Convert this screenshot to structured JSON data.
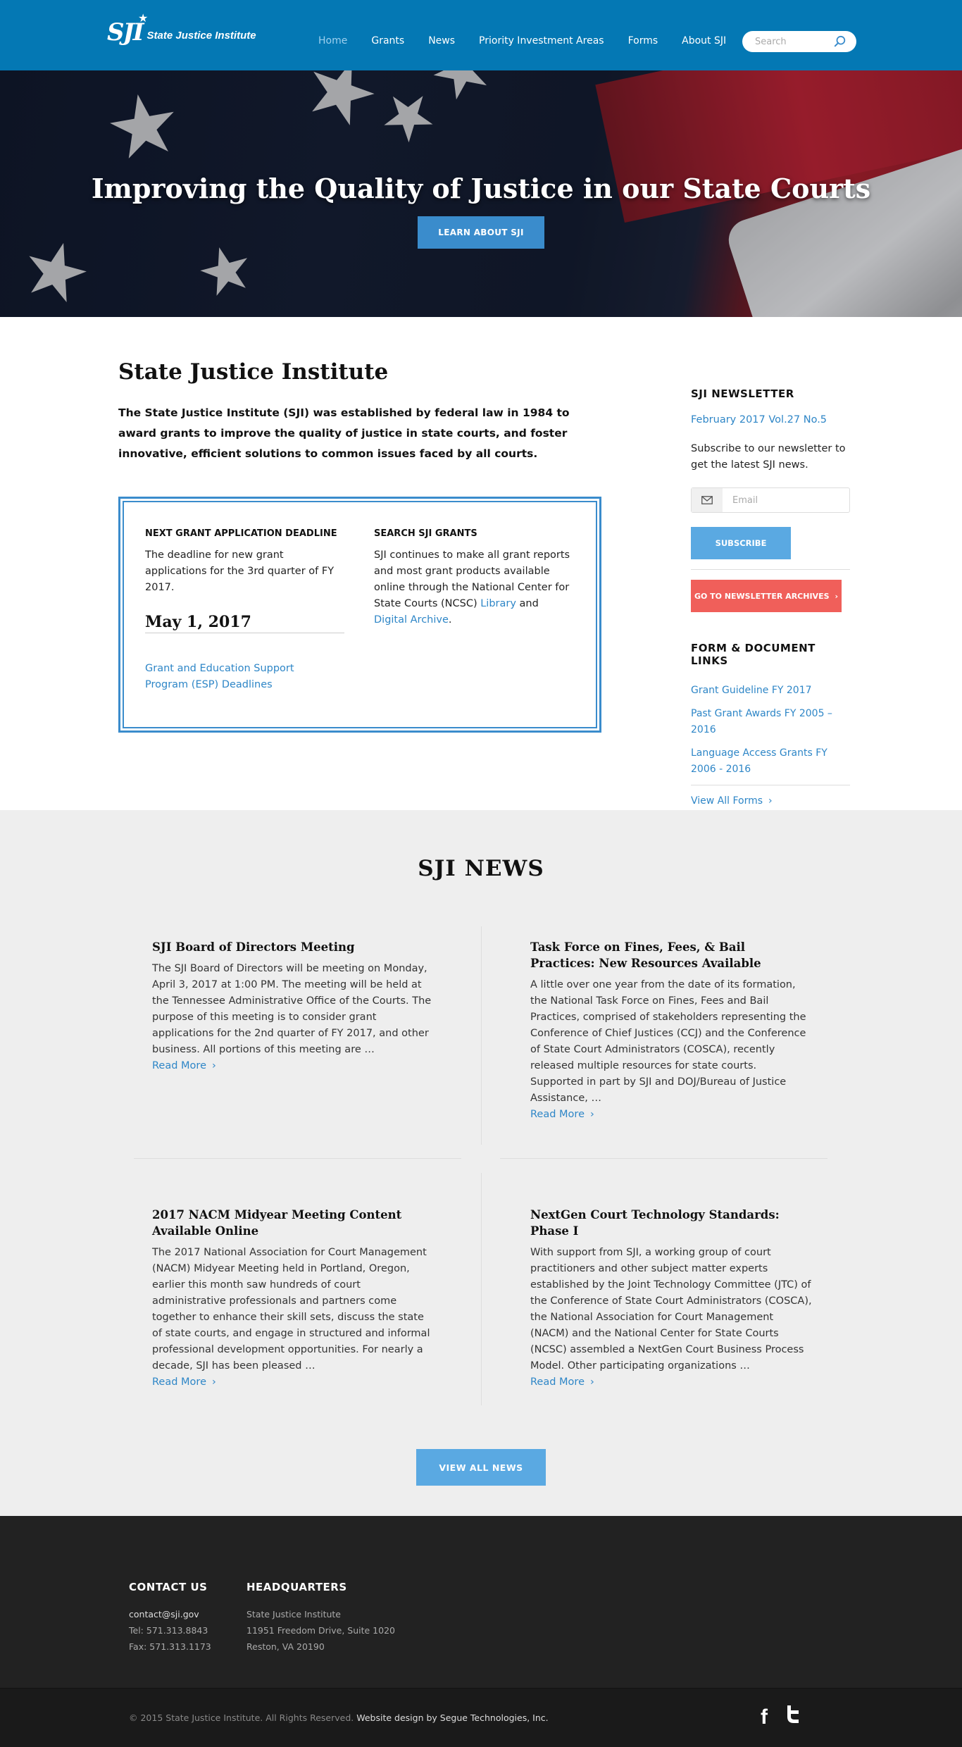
{
  "header": {
    "logo_mark": "SJI",
    "logo_text": "State Justice Institute",
    "nav": [
      "Home",
      "Grants",
      "News",
      "Priority Investment Areas",
      "Forms",
      "About SJI"
    ],
    "search_placeholder": "Search"
  },
  "hero": {
    "title": "Improving the Quality of Justice in our State Courts",
    "button": "LEARN ABOUT SJI"
  },
  "intro": {
    "title": "State Justice Institute",
    "text": "The State Justice Institute (SJI) was established by federal law in 1984 to award grants to improve the quality of justice in state courts, and foster innovative, efficient solutions to common issues faced by all courts."
  },
  "grant_box": {
    "deadline_heading": "NEXT GRANT APPLICATION DEADLINE",
    "deadline_text": "The deadline for new grant applications for the 3rd quarter of FY 2017.",
    "deadline_date": "May 1, 2017",
    "esp_link": "Grant and Education Support Program (ESP) Deadlines",
    "search_heading": "SEARCH SJI GRANTS",
    "search_text_1": "SJI continues to make all grant reports and most grant products available online through the National Center for State Courts (NCSC) ",
    "search_link_1": "Library",
    "search_text_2": " and ",
    "search_link_2": "Digital Archive",
    "search_text_3": "."
  },
  "sidebar": {
    "newsletter_heading": "SJI NEWSLETTER",
    "newsletter_issue": "February 2017 Vol.27 No.5",
    "newsletter_text": "Subscribe to our newsletter to get the latest SJI news.",
    "email_placeholder": "Email",
    "subscribe_button": "SUBSCRIBE",
    "archives_button": "GO TO NEWSLETTER ARCHIVES",
    "forms_heading": "FORM & DOCUMENT LINKS",
    "form_links": [
      "Grant Guideline FY 2017",
      "Past Grant Awards FY 2005 – 2016",
      "Language Access Grants FY 2006 - 2016"
    ],
    "view_all_forms": "View All Forms"
  },
  "news": {
    "title": "SJI NEWS",
    "articles": [
      {
        "title": "SJI Board of Directors Meeting",
        "body": "The SJI Board of Directors will be meeting on Monday, April 3, 2017 at 1:00 PM.  The meeting will be held at the Tennessee Administrative Office of the Courts.  The purpose of this meeting is to consider grant applications for the 2nd quarter of FY 2017, and other business.  All portions of this meeting are …",
        "more": "Read More"
      },
      {
        "title": "Task Force on Fines, Fees, & Bail Practices: New Resources Available",
        "body": "A little over one year from the date of its formation, the National Task Force on Fines, Fees and Bail Practices, comprised of stakeholders representing the Conference of Chief Justices (CCJ) and the Conference of State Court Administrators (COSCA), recently released multiple resources for state courts. Supported in part by SJI and DOJ/Bureau of Justice Assistance, …",
        "more": "Read More"
      },
      {
        "title": "2017 NACM Midyear Meeting Content Available Online",
        "body": "The 2017 National Association for Court Management (NACM) Midyear Meeting held in Portland, Oregon, earlier this month saw hundreds of court administrative professionals and partners come together to enhance their skill sets, discuss the state of state courts, and engage in structured and informal professional development opportunities. For nearly a decade, SJI has been pleased …",
        "more": "Read More"
      },
      {
        "title": "NextGen Court Technology Standards: Phase I",
        "body": "With support from SJI, a working group of court practitioners and other subject matter experts established by the Joint Technology Committee (JTC) of the Conference of State Court Administrators (COSCA), the National Association for Court Management (NACM) and the National Center for State Courts (NCSC) assembled a NextGen Court Business Process Model.  Other participating organizations …",
        "more": "Read More"
      }
    ],
    "view_all": "VIEW ALL NEWS"
  },
  "footer": {
    "contact_heading": "CONTACT US",
    "contact_email": "contact@sji.gov",
    "contact_tel": "Tel: 571.313.8843",
    "contact_fax": "Fax: 571.313.1173",
    "hq_heading": "HEADQUARTERS",
    "hq_line1": "State Justice Institute",
    "hq_line2": "11951 Freedom Drive, Suite 1020",
    "hq_line3": "Reston, VA 20190",
    "copyright": "© 2015 State Justice Institute. All Rights Reserved.",
    "designer": "Website design by Segue Technologies, Inc."
  },
  "icons": [
    "search-icon",
    "email-icon",
    "chevron-right-icon",
    "facebook-icon",
    "twitter-icon"
  ],
  "colors": {
    "header": "#0478b4",
    "accent": "#2e86c7",
    "button": "#5aa9e2",
    "archive_button": "#f05f5a",
    "footer": "#222222"
  }
}
